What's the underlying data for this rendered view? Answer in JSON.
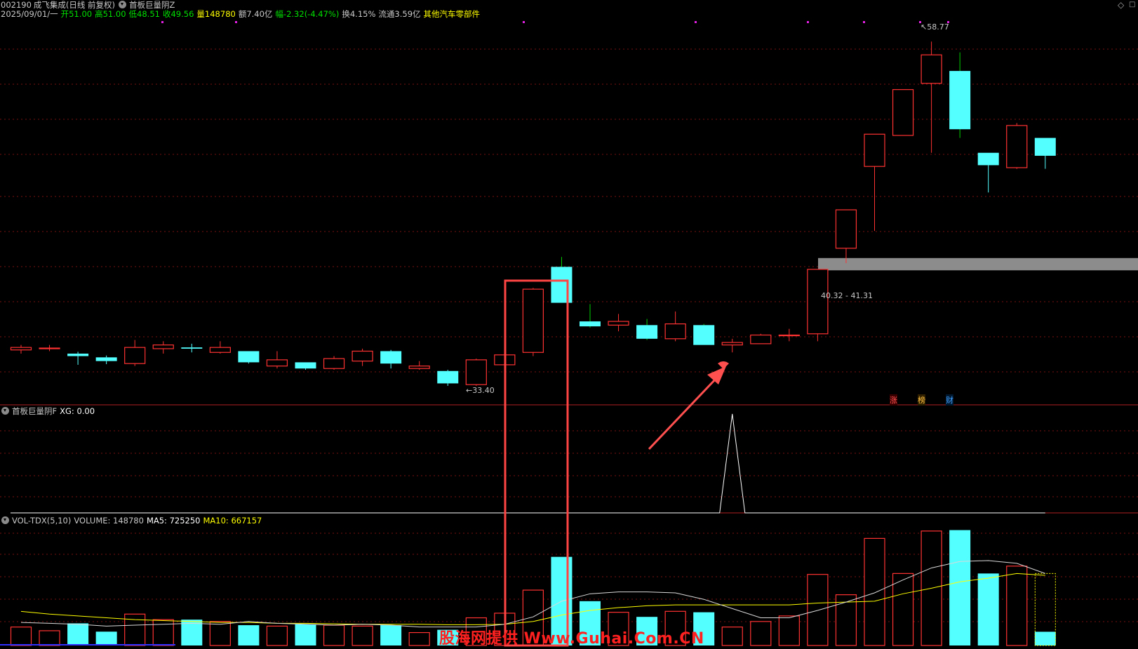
{
  "header": {
    "line1": {
      "code": "002190",
      "name": "成飞集成",
      "mode": "(日线 前复权)",
      "formula": "首板巨量阴Z"
    },
    "line2": {
      "date": "2025/09/01/一",
      "open": "开51.00",
      "high": "高51.00",
      "low": "低48.51",
      "close": "收49.56",
      "vol": "量148780",
      "amount": "额7.40亿",
      "change": "幅-2.32(-4.47%)",
      "turnover": "换4.15%",
      "float": "流通3.59亿",
      "industry": "其他汽车零部件"
    }
  },
  "price_panel": {
    "high_label": "58.77",
    "low_label": "33.40",
    "zone_label": "40.32 - 41.31",
    "tags": [
      "涨",
      "榜",
      "财"
    ]
  },
  "signal_panel": {
    "title": "首板巨量阴F",
    "value_text": "XG: 0.00"
  },
  "volume_panel": {
    "title": "VOL-TDX(5,10)",
    "volume_text": "VOLUME: 148780",
    "ma5_text": "MA5: 725250",
    "ma10_text": "MA10: 667157"
  },
  "watermark": "股海网提供 Www.Guhai.Com.CN",
  "colors": {
    "up": "#ff3232",
    "down": "#54ffff",
    "ma5": "#ffffff",
    "ma10": "#ffff00",
    "grid": "#7a1010",
    "highlight": "#ff4444",
    "zone": "#8c8c8c",
    "watermark": "#ff2020"
  },
  "chart_data": {
    "type": "candlestick",
    "candles": [
      {
        "o": 33.9,
        "c": 34.1,
        "h": 34.3,
        "l": 33.6
      },
      {
        "o": 34.0,
        "c": 34.05,
        "h": 34.3,
        "l": 33.8
      },
      {
        "o": 33.6,
        "c": 33.4,
        "h": 33.75,
        "l": 32.7
      },
      {
        "o": 33.3,
        "c": 33.0,
        "h": 33.45,
        "l": 32.75
      },
      {
        "o": 32.8,
        "c": 34.1,
        "h": 34.7,
        "l": 32.6
      },
      {
        "o": 34.0,
        "c": 34.3,
        "h": 34.6,
        "l": 33.6
      },
      {
        "o": 34.1,
        "c": 34.0,
        "h": 34.4,
        "l": 33.7
      },
      {
        "o": 33.7,
        "c": 34.1,
        "h": 34.6,
        "l": 33.6
      },
      {
        "o": 33.8,
        "c": 32.9,
        "h": 33.8,
        "l": 32.8
      },
      {
        "o": 32.6,
        "c": 33.1,
        "h": 33.8,
        "l": 32.4
      },
      {
        "o": 32.9,
        "c": 32.4,
        "h": 32.9,
        "l": 32.3
      },
      {
        "o": 32.4,
        "c": 33.2,
        "h": 33.4,
        "l": 32.3
      },
      {
        "o": 33.0,
        "c": 33.8,
        "h": 34.0,
        "l": 32.6
      },
      {
        "o": 33.8,
        "c": 32.8,
        "h": 33.9,
        "l": 32.4
      },
      {
        "o": 32.4,
        "c": 32.6,
        "h": 33.0,
        "l": 32.3
      },
      {
        "o": 32.2,
        "c": 31.2,
        "h": 32.3,
        "l": 31.0
      },
      {
        "o": 31.1,
        "c": 33.1,
        "h": 33.2,
        "l": 31.0
      },
      {
        "o": 32.7,
        "c": 33.5,
        "h": 35.3,
        "l": 32.7
      },
      {
        "o": 33.7,
        "c": 38.8,
        "h": 38.9,
        "l": 33.4
      },
      {
        "o": 40.6,
        "c": 37.7,
        "h": 41.4,
        "l": 37.7
      },
      {
        "o": 36.2,
        "c": 35.8,
        "h": 37.6,
        "l": 35.7
      },
      {
        "o": 35.9,
        "c": 36.2,
        "h": 36.8,
        "l": 35.4
      },
      {
        "o": 35.9,
        "c": 34.8,
        "h": 36.4,
        "l": 34.7
      },
      {
        "o": 34.8,
        "c": 36.0,
        "h": 37.0,
        "l": 34.6
      },
      {
        "o": 35.9,
        "c": 34.3,
        "h": 36.0,
        "l": 34.3
      },
      {
        "o": 34.3,
        "c": 34.5,
        "h": 34.8,
        "l": 33.7
      },
      {
        "o": 34.4,
        "c": 35.1,
        "h": 35.2,
        "l": 34.4
      },
      {
        "o": 35.1,
        "c": 35.1,
        "h": 35.6,
        "l": 34.6
      },
      {
        "o": 35.2,
        "c": 40.4,
        "h": 40.4,
        "l": 34.6
      },
      {
        "o": 42.1,
        "c": 45.2,
        "h": 45.2,
        "l": 40.9
      },
      {
        "o": 48.7,
        "c": 51.3,
        "h": 51.3,
        "l": 43.5
      },
      {
        "o": 51.2,
        "c": 54.9,
        "h": 54.9,
        "l": 51.2
      },
      {
        "o": 55.4,
        "c": 57.7,
        "h": 58.77,
        "l": 49.8
      },
      {
        "o": 56.4,
        "c": 51.7,
        "h": 57.9,
        "l": 51.0
      },
      {
        "o": 49.8,
        "c": 48.8,
        "h": 49.8,
        "l": 46.6
      },
      {
        "o": 48.6,
        "c": 52.0,
        "h": 52.2,
        "l": 48.5
      },
      {
        "o": 51.0,
        "c": 49.56,
        "h": 51.0,
        "l": 48.51
      }
    ],
    "volume": [
      200000,
      160000,
      240000,
      150000,
      340000,
      280000,
      280000,
      260000,
      220000,
      210000,
      230000,
      220000,
      210000,
      220000,
      140000,
      170000,
      300000,
      350000,
      600000,
      960000,
      480000,
      360000,
      310000,
      370000,
      360000,
      200000,
      260000,
      320000,
      770000,
      550000,
      1160000,
      780000,
      1240000,
      1250000,
      780000,
      860000,
      148780
    ],
    "ma5": [
      250000,
      240000,
      230000,
      210000,
      220000,
      230000,
      240000,
      230000,
      260000,
      240000,
      230000,
      220000,
      230000,
      220000,
      200000,
      200000,
      200000,
      230000,
      310000,
      480000,
      560000,
      580000,
      580000,
      570000,
      500000,
      400000,
      300000,
      300000,
      380000,
      470000,
      570000,
      710000,
      840000,
      910000,
      920000,
      890000,
      780000
    ],
    "ma10": [
      370000,
      340000,
      320000,
      300000,
      280000,
      270000,
      260000,
      250000,
      250000,
      240000,
      240000,
      235000,
      230000,
      230000,
      230000,
      225000,
      225000,
      230000,
      260000,
      330000,
      380000,
      410000,
      430000,
      440000,
      440000,
      440000,
      440000,
      440000,
      460000,
      470000,
      480000,
      560000,
      620000,
      690000,
      730000,
      780000,
      760000
    ],
    "signal": [
      0,
      0,
      0,
      0,
      0,
      0,
      0,
      0,
      0,
      0,
      0,
      0,
      0,
      0,
      0,
      0,
      0,
      0,
      0,
      0,
      0,
      0,
      0,
      0,
      0,
      1,
      0,
      0,
      0,
      0,
      0,
      0,
      0,
      0,
      0,
      0,
      0
    ],
    "ylim_price": [
      29.3,
      60.2
    ],
    "ylim_volume": [
      0,
      1330000
    ]
  }
}
